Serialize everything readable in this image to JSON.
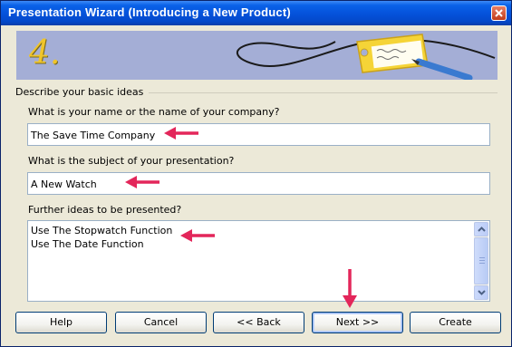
{
  "window": {
    "title": "Presentation Wizard (Introducing a New Product)"
  },
  "banner": {
    "step_number": "4."
  },
  "group": {
    "label": "Describe your basic ideas"
  },
  "fields": {
    "name": {
      "label": "What is your name or the name of your company?",
      "value": "The Save Time Company"
    },
    "subject": {
      "label": "What is the subject of your presentation?",
      "value": "A New Watch"
    },
    "ideas": {
      "label": "Further ideas to be presented?",
      "lines": [
        "Use The Stopwatch Function",
        "Use The Date Function"
      ]
    }
  },
  "buttons": {
    "help": "Help",
    "cancel": "Cancel",
    "back": "<< Back",
    "next": "Next >>",
    "create": "Create"
  },
  "colors": {
    "arrow": "#e3265a",
    "titlebar": "#0553dc",
    "banner_bg": "#a4aed6",
    "tag": "#f5d437"
  },
  "icons": [
    "close-icon",
    "scroll-up-icon",
    "scroll-down-icon",
    "pointer-arrow"
  ]
}
